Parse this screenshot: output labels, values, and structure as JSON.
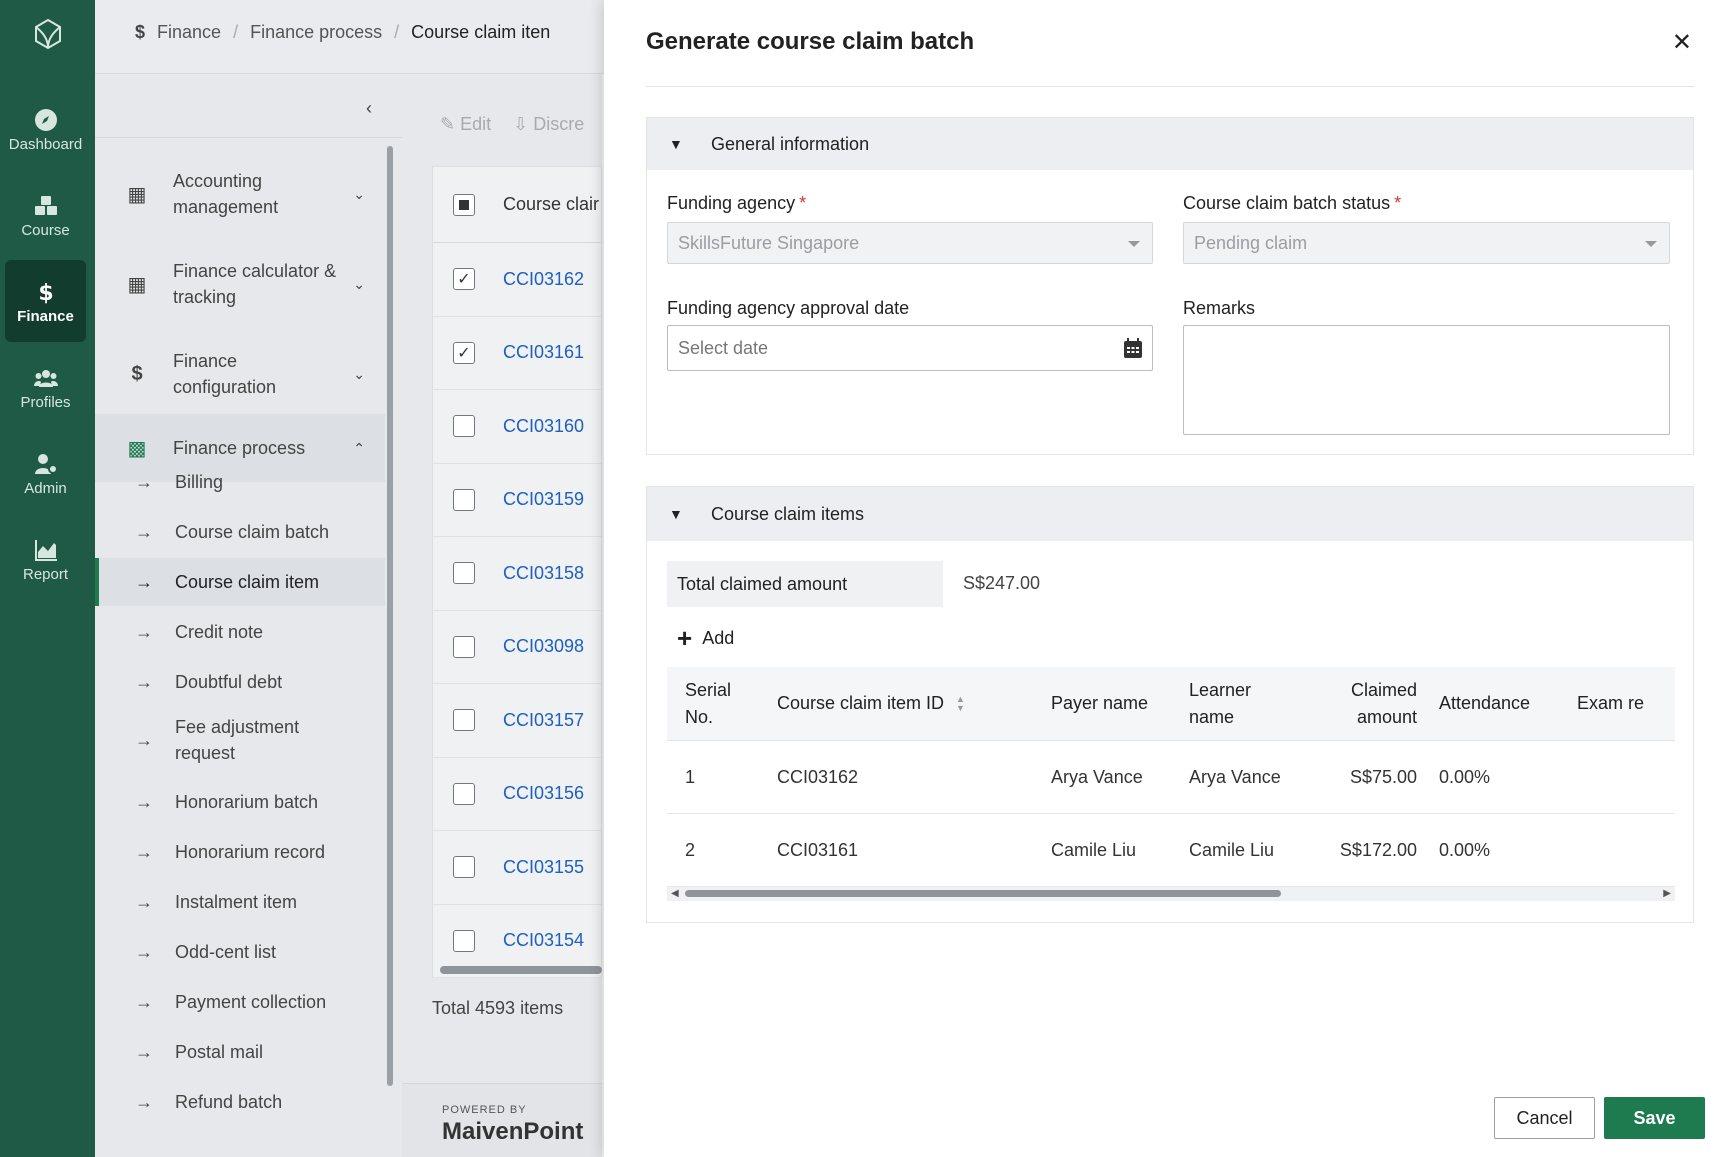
{
  "rail": {
    "items": [
      {
        "label": "Dashboard",
        "icon": "compass-icon"
      },
      {
        "label": "Course",
        "icon": "cubes-icon"
      },
      {
        "label": "Finance",
        "icon": "dollar-icon",
        "active": true
      },
      {
        "label": "Profiles",
        "icon": "users-icon"
      },
      {
        "label": "Admin",
        "icon": "user-gear-icon"
      },
      {
        "label": "Report",
        "icon": "chart-icon"
      }
    ]
  },
  "breadcrumb": [
    "Finance",
    "Finance process",
    "Course claim iten"
  ],
  "subnav": {
    "groups": [
      {
        "label": "Accounting management",
        "icon": "calendar-icon"
      },
      {
        "label": "Finance calculator & tracking",
        "icon": "calculator-icon"
      },
      {
        "label": "Finance configuration",
        "icon": "dollar-icon"
      },
      {
        "label": "Finance process",
        "icon": "money-icon"
      }
    ],
    "items": [
      "Billing",
      "Course claim batch",
      "Course claim item",
      "Credit note",
      "Doubtful debt",
      "Fee adjustment request",
      "Honorarium batch",
      "Honorarium record",
      "Instalment item",
      "Odd-cent list",
      "Payment collection",
      "Postal mail",
      "Refund batch"
    ],
    "active_item": "Course claim item"
  },
  "toolbar": {
    "edit": "Edit",
    "discard": "Discre"
  },
  "grid": {
    "header": "Course clair",
    "rows": [
      {
        "id": "CCI03162",
        "checked": true
      },
      {
        "id": "CCI03161",
        "checked": true
      },
      {
        "id": "CCI03160",
        "checked": false
      },
      {
        "id": "CCI03159",
        "checked": false
      },
      {
        "id": "CCI03158",
        "checked": false
      },
      {
        "id": "CCI03098",
        "checked": false
      },
      {
        "id": "CCI03157",
        "checked": false
      },
      {
        "id": "CCI03156",
        "checked": false
      },
      {
        "id": "CCI03155",
        "checked": false
      },
      {
        "id": "CCI03154",
        "checked": false
      }
    ],
    "total": "Total 4593 items"
  },
  "footer": {
    "powered": "POWERED BY",
    "brand": "MaivenPoint"
  },
  "drawer": {
    "title": "Generate course claim batch",
    "general": {
      "heading": "General information",
      "funding_agency_label": "Funding agency",
      "funding_agency_value": "SkillsFuture Singapore",
      "status_label": "Course claim batch status",
      "status_value": "Pending claim",
      "approval_date_label": "Funding agency approval date",
      "approval_date_placeholder": "Select date",
      "remarks_label": "Remarks"
    },
    "items": {
      "heading": "Course claim items",
      "total_label": "Total claimed amount",
      "total_value": "S$247.00",
      "add_label": "Add",
      "columns": [
        "Serial No.",
        "Course claim item ID",
        "Payer name",
        "Learner name",
        "Claimed amount",
        "Attendance",
        "Exam re"
      ],
      "rows": [
        {
          "serial": "1",
          "id": "CCI03162",
          "payer": "Arya Vance",
          "learner": "Arya Vance",
          "amount": "S$75.00",
          "attendance": "0.00%"
        },
        {
          "serial": "2",
          "id": "CCI03161",
          "payer": "Camile Liu",
          "learner": "Camile Liu",
          "amount": "S$172.00",
          "attendance": "0.00%"
        }
      ]
    },
    "cancel": "Cancel",
    "save": "Save"
  },
  "colors": {
    "rail": "#1e5a45",
    "accent": "#1e7a4f",
    "link": "#1f5fbf",
    "required": "#d0343a"
  }
}
